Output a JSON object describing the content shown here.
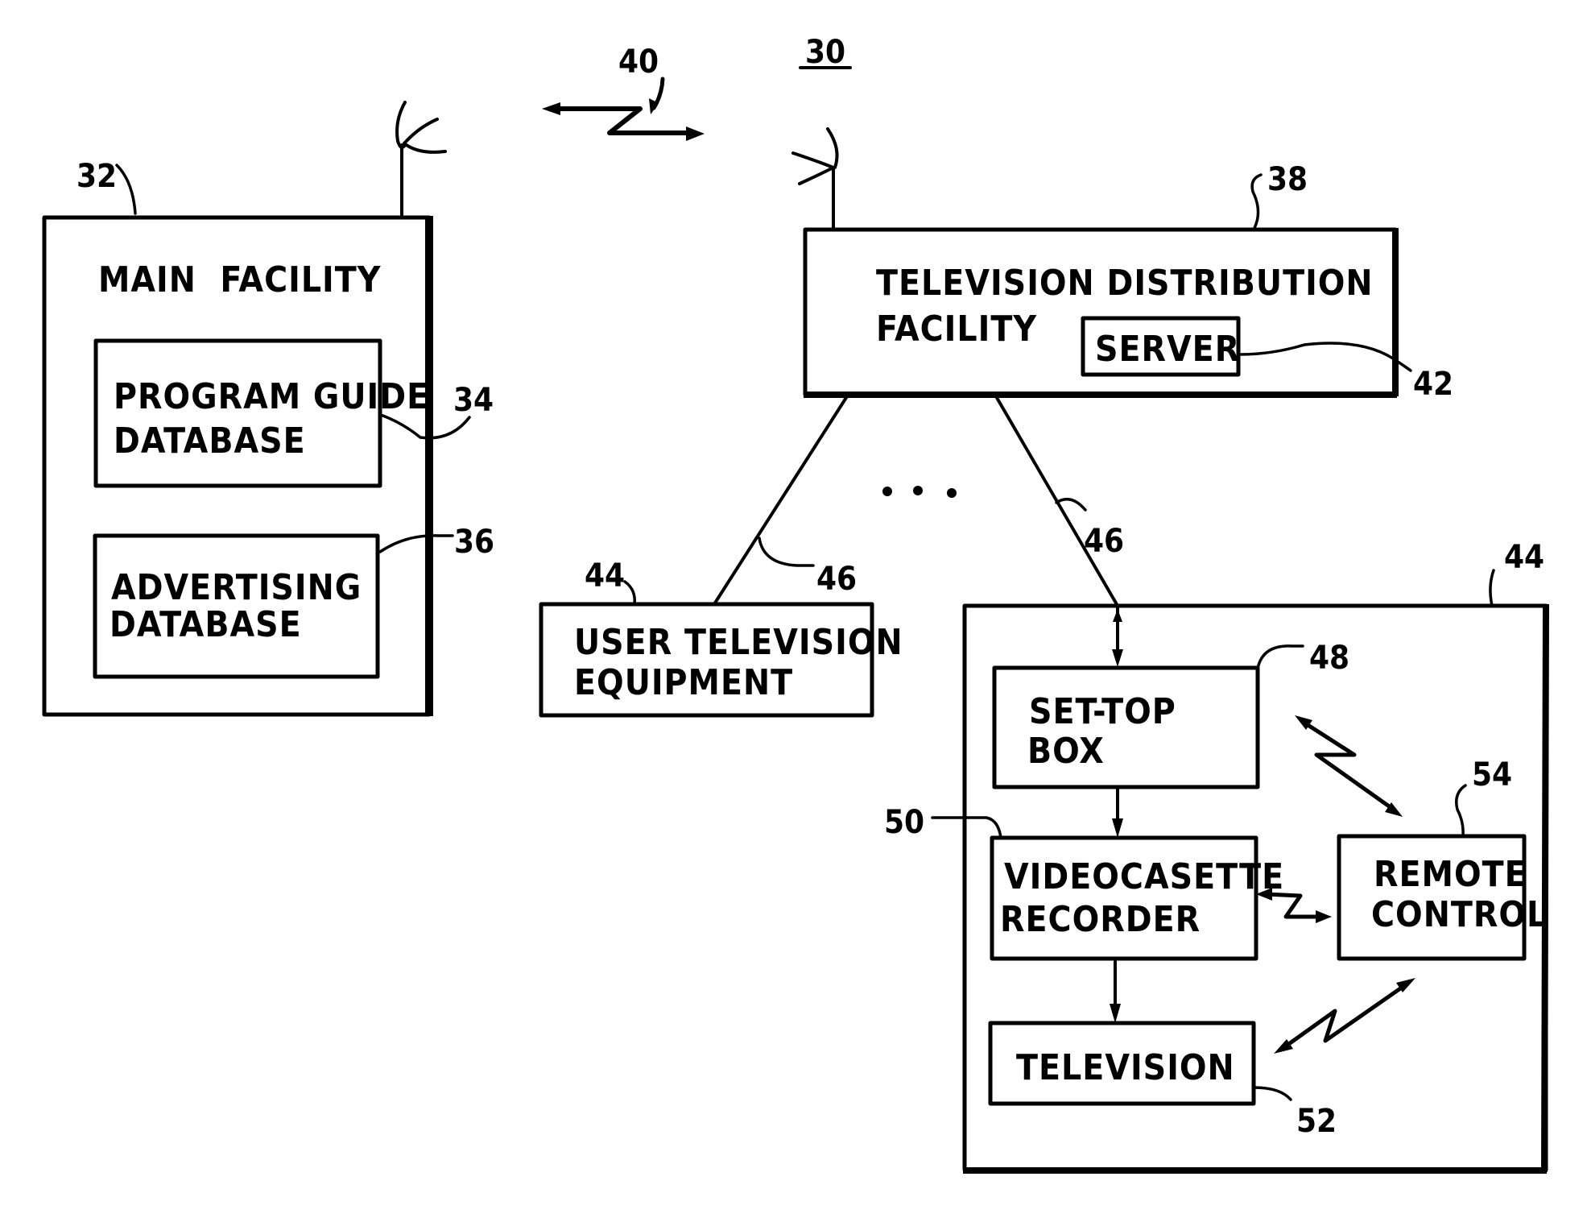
{
  "figure": {
    "reference_number": "30",
    "link_reference": "40",
    "main_facility": {
      "ref": "32",
      "title_line1": "MAIN  FACILITY",
      "program_guide_db": {
        "ref": "34",
        "line1": "PROGRAM GUIDE",
        "line2": "DATABASE"
      },
      "advertising_db": {
        "ref": "36",
        "line1": "ADVERTISING",
        "line2": "DATABASE"
      }
    },
    "distribution_facility": {
      "ref": "38",
      "line1": "TELEVISION DISTRIBUTION",
      "line2": "FACILITY",
      "server": {
        "ref": "42",
        "label": "SERVER"
      }
    },
    "communication_paths": {
      "ref_left": "46",
      "ref_right": "46"
    },
    "ellipsis": "• • •",
    "user_equipment_simple": {
      "ref": "44",
      "line1": "USER TELEVISION",
      "line2": "EQUIPMENT"
    },
    "user_equipment_detail": {
      "ref": "44",
      "set_top_box": {
        "ref": "48",
        "line1": "SET-TOP",
        "line2": "BOX"
      },
      "vcr": {
        "ref": "50",
        "line1": "VIDEOCASETTE",
        "line2": "RECORDER"
      },
      "television": {
        "ref": "52",
        "label": "TELEVISION"
      },
      "remote_control": {
        "ref": "54",
        "line1": "REMOTE",
        "line2": "CONTROL"
      }
    }
  }
}
